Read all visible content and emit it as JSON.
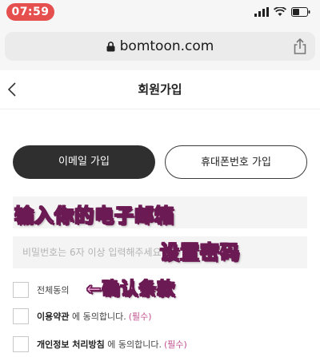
{
  "status_bar": {
    "time": "07:59",
    "icons": [
      "signal-icon",
      "wifi-icon",
      "battery-icon"
    ]
  },
  "browser": {
    "url": "bomtoon.com",
    "icons": [
      "lock-icon",
      "share-icon"
    ]
  },
  "header": {
    "title": "회원가입",
    "back_icon": "chevron-left-icon"
  },
  "tabs": {
    "email": "이메일 가입",
    "phone": "휴대폰번호 가입"
  },
  "form": {
    "email": {
      "value": "",
      "placeholder": ""
    },
    "password": {
      "value": "",
      "placeholder": "비밀번호는 6자 이상 입력해주세요"
    }
  },
  "annotations": {
    "email": "输入你的电子邮箱",
    "password": "设置密码",
    "terms": "←确认条款"
  },
  "agreements": {
    "all": "전체동의",
    "terms_bold": "이용약관",
    "terms_rest": " 에 동의합니다.",
    "privacy_bold": "개인정보 처리방침",
    "privacy_rest": " 에 동의합니다.",
    "required": "(필수)"
  },
  "colors": {
    "status_time_bg": "#e5504f",
    "tab_active_bg": "#2f2f2f",
    "annotation_fill": "#ffb6e1",
    "annotation_outline": "#6b1a53",
    "required_text": "#c0508e"
  }
}
